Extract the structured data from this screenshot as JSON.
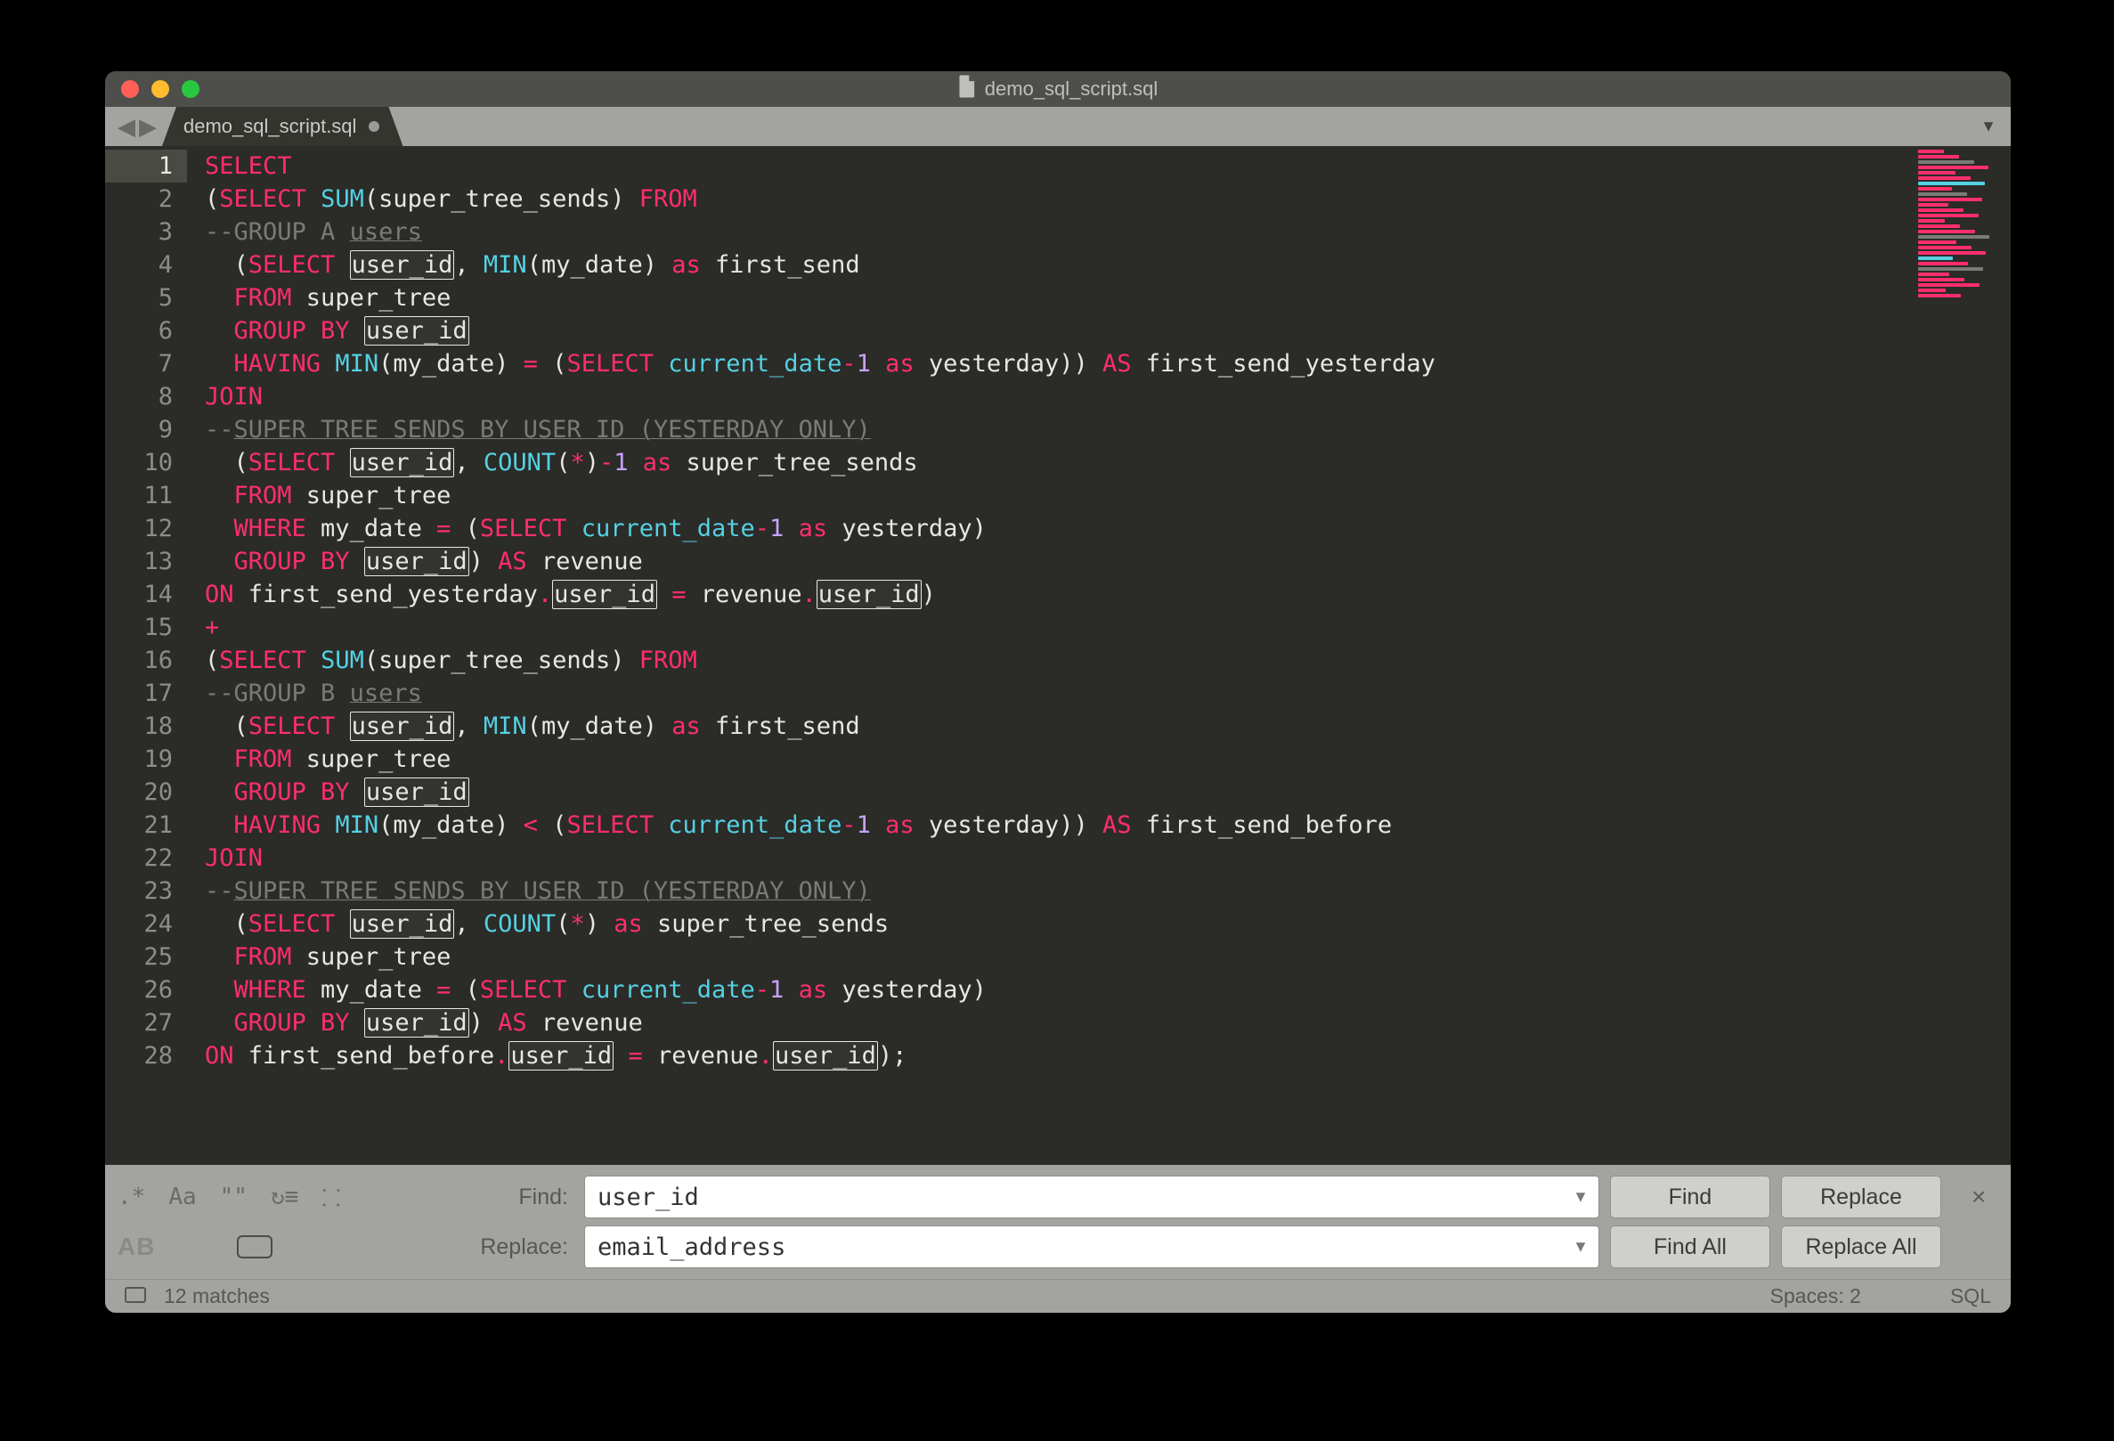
{
  "window": {
    "title": "demo_sql_script.sql"
  },
  "tab": {
    "label": "demo_sql_script.sql",
    "modified": true
  },
  "code": {
    "lines": [
      [
        {
          "t": "SELECT",
          "c": "kw"
        }
      ],
      [
        {
          "t": "(",
          "c": "pn"
        },
        {
          "t": "SELECT",
          "c": "kw"
        },
        {
          "t": " "
        },
        {
          "t": "SUM",
          "c": "fn"
        },
        {
          "t": "(super_tree_sends) ",
          "c": "pn"
        },
        {
          "t": "FROM",
          "c": "kw"
        }
      ],
      [
        {
          "t": "--",
          "c": "cm"
        },
        {
          "t": "GROUP A ",
          "c": "cm"
        },
        {
          "t": "users",
          "c": "cm-u"
        }
      ],
      [
        {
          "t": "  (",
          "c": "pn"
        },
        {
          "t": "SELECT",
          "c": "kw"
        },
        {
          "t": " "
        },
        {
          "t": "user_id",
          "c": "hl"
        },
        {
          "t": ", ",
          "c": "pn"
        },
        {
          "t": "MIN",
          "c": "fn"
        },
        {
          "t": "(my_date) ",
          "c": "pn"
        },
        {
          "t": "as",
          "c": "kw"
        },
        {
          "t": " first_send",
          "c": "pn"
        }
      ],
      [
        {
          "t": "  "
        },
        {
          "t": "FROM",
          "c": "kw"
        },
        {
          "t": " super_tree",
          "c": "pn"
        }
      ],
      [
        {
          "t": "  "
        },
        {
          "t": "GROUP BY",
          "c": "kw"
        },
        {
          "t": " "
        },
        {
          "t": "user_id",
          "c": "hl"
        }
      ],
      [
        {
          "t": "  "
        },
        {
          "t": "HAVING",
          "c": "kw"
        },
        {
          "t": " "
        },
        {
          "t": "MIN",
          "c": "fn"
        },
        {
          "t": "(my_date) ",
          "c": "pn"
        },
        {
          "t": "=",
          "c": "kw"
        },
        {
          "t": " (",
          "c": "pn"
        },
        {
          "t": "SELECT",
          "c": "kw"
        },
        {
          "t": " "
        },
        {
          "t": "current_date",
          "c": "fn"
        },
        {
          "t": "-",
          "c": "kw"
        },
        {
          "t": "1",
          "c": "num"
        },
        {
          "t": " "
        },
        {
          "t": "as",
          "c": "kw"
        },
        {
          "t": " yesterday)) ",
          "c": "pn"
        },
        {
          "t": "AS",
          "c": "kw"
        },
        {
          "t": " first_send_yesterday",
          "c": "pn"
        }
      ],
      [
        {
          "t": "JOIN",
          "c": "kw"
        }
      ],
      [
        {
          "t": "--",
          "c": "cm"
        },
        {
          "t": "SUPER TREE SENDS BY USER ID (YESTERDAY ONLY)",
          "c": "cm-u"
        }
      ],
      [
        {
          "t": "  (",
          "c": "pn"
        },
        {
          "t": "SELECT",
          "c": "kw"
        },
        {
          "t": " "
        },
        {
          "t": "user_id",
          "c": "hl"
        },
        {
          "t": ", ",
          "c": "pn"
        },
        {
          "t": "COUNT",
          "c": "fn"
        },
        {
          "t": "(",
          "c": "pn"
        },
        {
          "t": "*",
          "c": "kw"
        },
        {
          "t": ")",
          "c": "pn"
        },
        {
          "t": "-",
          "c": "kw"
        },
        {
          "t": "1",
          "c": "num"
        },
        {
          "t": " "
        },
        {
          "t": "as",
          "c": "kw"
        },
        {
          "t": " super_tree_sends",
          "c": "pn"
        }
      ],
      [
        {
          "t": "  "
        },
        {
          "t": "FROM",
          "c": "kw"
        },
        {
          "t": " super_tree",
          "c": "pn"
        }
      ],
      [
        {
          "t": "  "
        },
        {
          "t": "WHERE",
          "c": "kw"
        },
        {
          "t": " my_date ",
          "c": "pn"
        },
        {
          "t": "=",
          "c": "kw"
        },
        {
          "t": " (",
          "c": "pn"
        },
        {
          "t": "SELECT",
          "c": "kw"
        },
        {
          "t": " "
        },
        {
          "t": "current_date",
          "c": "fn"
        },
        {
          "t": "-",
          "c": "kw"
        },
        {
          "t": "1",
          "c": "num"
        },
        {
          "t": " "
        },
        {
          "t": "as",
          "c": "kw"
        },
        {
          "t": " yesterday)",
          "c": "pn"
        }
      ],
      [
        {
          "t": "  "
        },
        {
          "t": "GROUP BY",
          "c": "kw"
        },
        {
          "t": " "
        },
        {
          "t": "user_id",
          "c": "hl"
        },
        {
          "t": ") ",
          "c": "pn"
        },
        {
          "t": "AS",
          "c": "kw"
        },
        {
          "t": " revenue",
          "c": "pn"
        }
      ],
      [
        {
          "t": "ON",
          "c": "kw"
        },
        {
          "t": " first_send_yesterday",
          "c": "pn"
        },
        {
          "t": ".",
          "c": "kw"
        },
        {
          "t": "user_id",
          "c": "hl"
        },
        {
          "t": " ",
          "c": "pn"
        },
        {
          "t": "=",
          "c": "kw"
        },
        {
          "t": " revenue",
          "c": "pn"
        },
        {
          "t": ".",
          "c": "kw"
        },
        {
          "t": "user_id",
          "c": "hl"
        },
        {
          "t": ")",
          "c": "pn"
        }
      ],
      [
        {
          "t": "+",
          "c": "kw"
        }
      ],
      [
        {
          "t": "(",
          "c": "pn"
        },
        {
          "t": "SELECT",
          "c": "kw"
        },
        {
          "t": " "
        },
        {
          "t": "SUM",
          "c": "fn"
        },
        {
          "t": "(super_tree_sends) ",
          "c": "pn"
        },
        {
          "t": "FROM",
          "c": "kw"
        }
      ],
      [
        {
          "t": "--",
          "c": "cm"
        },
        {
          "t": "GROUP B ",
          "c": "cm"
        },
        {
          "t": "users",
          "c": "cm-u"
        }
      ],
      [
        {
          "t": "  (",
          "c": "pn"
        },
        {
          "t": "SELECT",
          "c": "kw"
        },
        {
          "t": " "
        },
        {
          "t": "user_id",
          "c": "hl"
        },
        {
          "t": ", ",
          "c": "pn"
        },
        {
          "t": "MIN",
          "c": "fn"
        },
        {
          "t": "(my_date) ",
          "c": "pn"
        },
        {
          "t": "as",
          "c": "kw"
        },
        {
          "t": " first_send",
          "c": "pn"
        }
      ],
      [
        {
          "t": "  "
        },
        {
          "t": "FROM",
          "c": "kw"
        },
        {
          "t": " super_tree",
          "c": "pn"
        }
      ],
      [
        {
          "t": "  "
        },
        {
          "t": "GROUP BY",
          "c": "kw"
        },
        {
          "t": " "
        },
        {
          "t": "user_id",
          "c": "hl"
        }
      ],
      [
        {
          "t": "  "
        },
        {
          "t": "HAVING",
          "c": "kw"
        },
        {
          "t": " "
        },
        {
          "t": "MIN",
          "c": "fn"
        },
        {
          "t": "(my_date) ",
          "c": "pn"
        },
        {
          "t": "<",
          "c": "kw"
        },
        {
          "t": " (",
          "c": "pn"
        },
        {
          "t": "SELECT",
          "c": "kw"
        },
        {
          "t": " "
        },
        {
          "t": "current_date",
          "c": "fn"
        },
        {
          "t": "-",
          "c": "kw"
        },
        {
          "t": "1",
          "c": "num"
        },
        {
          "t": " "
        },
        {
          "t": "as",
          "c": "kw"
        },
        {
          "t": " yesterday)) ",
          "c": "pn"
        },
        {
          "t": "AS",
          "c": "kw"
        },
        {
          "t": " first_send_before",
          "c": "pn"
        }
      ],
      [
        {
          "t": "JOIN",
          "c": "kw"
        }
      ],
      [
        {
          "t": "--",
          "c": "cm"
        },
        {
          "t": "SUPER TREE SENDS BY USER ID (YESTERDAY ONLY)",
          "c": "cm-u"
        }
      ],
      [
        {
          "t": "  (",
          "c": "pn"
        },
        {
          "t": "SELECT",
          "c": "kw"
        },
        {
          "t": " "
        },
        {
          "t": "user_id",
          "c": "hl"
        },
        {
          "t": ", ",
          "c": "pn"
        },
        {
          "t": "COUNT",
          "c": "fn"
        },
        {
          "t": "(",
          "c": "pn"
        },
        {
          "t": "*",
          "c": "kw"
        },
        {
          "t": ") ",
          "c": "pn"
        },
        {
          "t": "as",
          "c": "kw"
        },
        {
          "t": " super_tree_sends",
          "c": "pn"
        }
      ],
      [
        {
          "t": "  "
        },
        {
          "t": "FROM",
          "c": "kw"
        },
        {
          "t": " super_tree",
          "c": "pn"
        }
      ],
      [
        {
          "t": "  "
        },
        {
          "t": "WHERE",
          "c": "kw"
        },
        {
          "t": " my_date ",
          "c": "pn"
        },
        {
          "t": "=",
          "c": "kw"
        },
        {
          "t": " (",
          "c": "pn"
        },
        {
          "t": "SELECT",
          "c": "kw"
        },
        {
          "t": " "
        },
        {
          "t": "current_date",
          "c": "fn"
        },
        {
          "t": "-",
          "c": "kw"
        },
        {
          "t": "1",
          "c": "num"
        },
        {
          "t": " "
        },
        {
          "t": "as",
          "c": "kw"
        },
        {
          "t": " yesterday)",
          "c": "pn"
        }
      ],
      [
        {
          "t": "  "
        },
        {
          "t": "GROUP BY",
          "c": "kw"
        },
        {
          "t": " "
        },
        {
          "t": "user_id",
          "c": "hl"
        },
        {
          "t": ") ",
          "c": "pn"
        },
        {
          "t": "AS",
          "c": "kw"
        },
        {
          "t": " revenue",
          "c": "pn"
        }
      ],
      [
        {
          "t": "ON",
          "c": "kw"
        },
        {
          "t": " first_send_before",
          "c": "pn"
        },
        {
          "t": ".",
          "c": "kw"
        },
        {
          "t": "user_id",
          "c": "hl"
        },
        {
          "t": " ",
          "c": "pn"
        },
        {
          "t": "=",
          "c": "kw"
        },
        {
          "t": " revenue",
          "c": "pn"
        },
        {
          "t": ".",
          "c": "kw"
        },
        {
          "t": "user_id",
          "c": "hl"
        },
        {
          "t": ");",
          "c": "pn"
        }
      ]
    ]
  },
  "find": {
    "find_label": "Find:",
    "replace_label": "Replace:",
    "find_value": "user_id",
    "replace_value": "email_address",
    "btn_find": "Find",
    "btn_replace": "Replace",
    "btn_find_all": "Find All",
    "btn_replace_all": "Replace All",
    "opt_regex": ".*",
    "opt_case": "Aa",
    "opt_quote": "\"\"",
    "opt_wrap": "↻≡",
    "opt_sel": "⸬",
    "opt_preserve": "AB"
  },
  "status": {
    "matches": "12 matches",
    "spaces": "Spaces: 2",
    "syntax": "SQL"
  },
  "minimap_colors": [
    "#ff2e6d",
    "#ff2e6d",
    "#7b7b75",
    "#ff2e6d",
    "#ff2e6d",
    "#ff2e6d",
    "#54d1e3",
    "#ff2e6d",
    "#7b7b75",
    "#ff2e6d",
    "#ff2e6d",
    "#ff2e6d",
    "#ff2e6d",
    "#ff2e6d",
    "#ff2e6d",
    "#ff2e6d",
    "#7b7b75",
    "#ff2e6d",
    "#ff2e6d",
    "#ff2e6d",
    "#54d1e3",
    "#ff2e6d",
    "#7b7b75",
    "#ff2e6d",
    "#ff2e6d",
    "#ff2e6d",
    "#ff2e6d",
    "#ff2e6d"
  ]
}
